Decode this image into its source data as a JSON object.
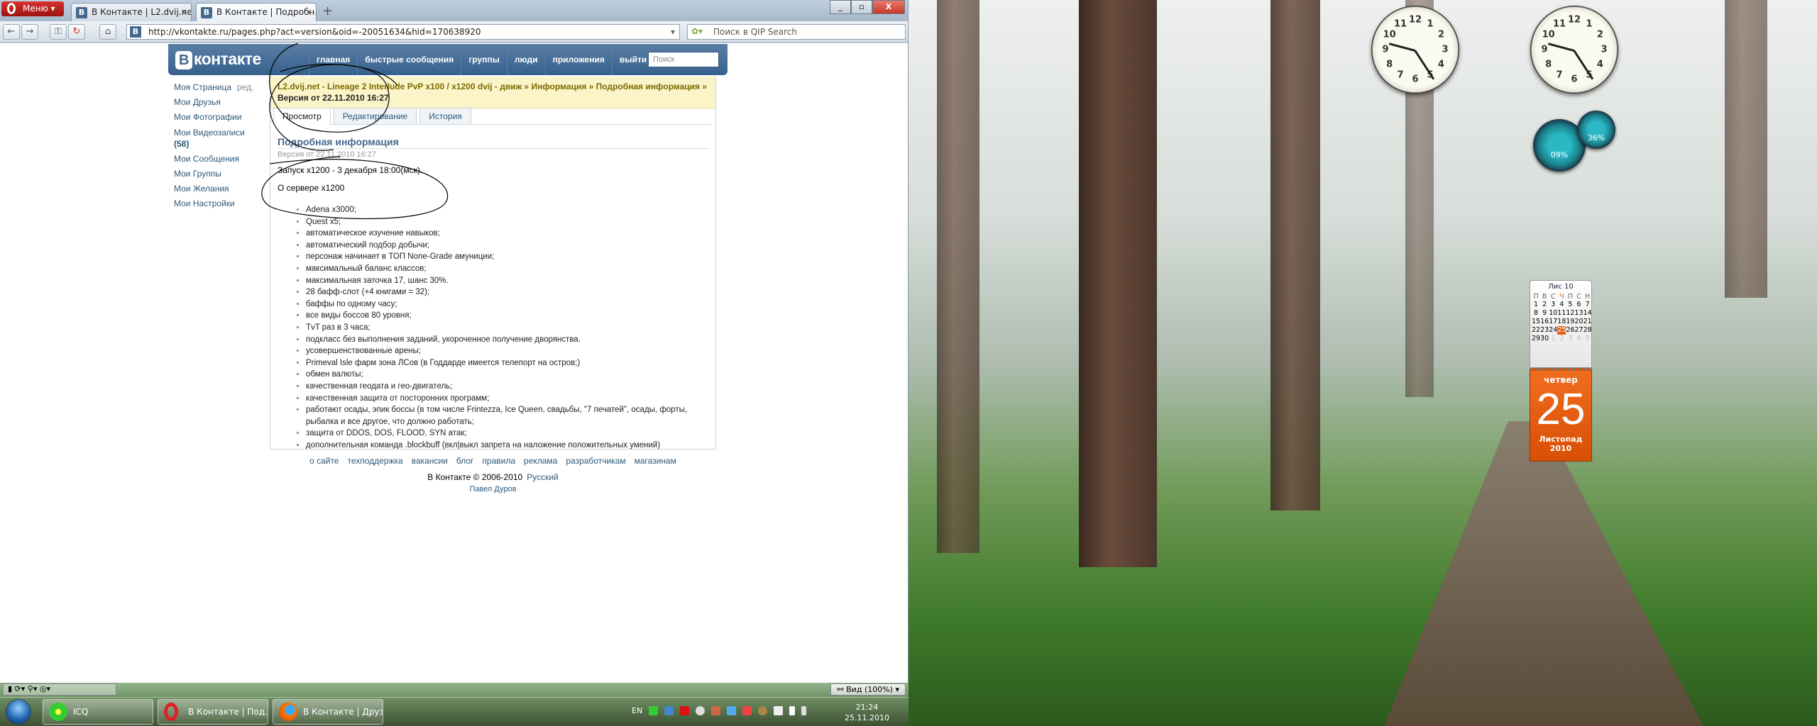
{
  "browser": {
    "menu_label": "Меню",
    "tabs": [
      {
        "label": "В Контакте | L2.dvij.ne...",
        "active": false
      },
      {
        "label": "В Контакте | Подробн...",
        "active": true
      }
    ],
    "url": "http://vkontakte.ru/pages.php?act=version&oid=-20051634&hid=170638920",
    "search_placeholder": "Поиск в QIP Search",
    "zoom_label": "Вид (100%)"
  },
  "vk": {
    "logo": "контакте",
    "logo_letter": "В",
    "nav": [
      "главная",
      "быстрые сообщения",
      "группы",
      "люди",
      "приложения",
      "выйти"
    ],
    "search_placeholder": "Поиск",
    "sidebar": [
      {
        "label": "Моя Страница",
        "extra": "ред."
      },
      {
        "label": "Мои Друзья"
      },
      {
        "label": "Мои Фотографии"
      },
      {
        "label": "Мои Видеозаписи",
        "count": "(58)"
      },
      {
        "label": "Мои Сообщения"
      },
      {
        "label": "Мои Группы"
      },
      {
        "label": "Мои Желания"
      },
      {
        "label": "Мои Настройки"
      }
    ],
    "breadcrumb": "L2.dvij.net - Lineage 2 Interlude PvP x100 / x1200 dvij - движ » Информация » Подробная информация »",
    "breadcrumb_current": "Версия от 22.11.2010 16:27",
    "tabs": [
      "Просмотр",
      "Редактирование",
      "История"
    ],
    "page_title": "Подробная информация",
    "version_line": "Версия от 22.11.2010 16:27",
    "launch": "Запуск x1200 - 3 декабря 18:00(мск).",
    "about": "О сервере x1200",
    "features": [
      "Adena x3000;",
      "Quest x5;",
      "автоматическое изучение навыков;",
      "автоматический подбор добычи;",
      "персонаж начинает в ТОП None-Grade амуниции;",
      "максимальный баланс классов;",
      "максимальная заточка 17, шанс 30%.",
      "28 бафф-слот (+4 книгами = 32);",
      "баффы по одному часу;",
      "все виды боссов 80 уровня;",
      "TvT раз в 3 часа;",
      "подкласс без выполнения заданий, укороченное получение дворянства.",
      "усовершенствованные арены;",
      "Primeval Isle фарм зона ЛСов (в Годдарде имеется телепорт на остров;)",
      "обмен валюты;",
      "качественная геодата и гео-двигатель;",
      "качественная защита от посторонних программ;",
      "работают осады, эпик боссы (в том числе Frintezza, Ice Queen, свадьбы, \"7 печатей\", осады, форты, рыбалка и все другое, что должно работать;",
      "защита от DDOS, DOS, FLOOD, SYN атак;",
      "дополнительная команда .blockbuff (вкл|выкл запрета на наложение положительных умений)"
    ],
    "footer_links": [
      "о сайте",
      "техподдержка",
      "вакансии",
      "блог",
      "правила",
      "реклама",
      "разработчикам",
      "магазинам"
    ],
    "copyright": "В Контакте © 2006-2010",
    "language": "Русский",
    "author": "Павел Дуров"
  },
  "taskbar": {
    "items": [
      {
        "label": "ICQ",
        "icon": "icq-flower-icon"
      },
      {
        "label": "В Контакте | Под...",
        "icon": "opera-icon"
      },
      {
        "label": "В Контакте | Друз...",
        "icon": "firefox-icon"
      }
    ],
    "lang": "EN",
    "time": "21:24",
    "date": "25.11.2010"
  },
  "gadgets": {
    "cpu": "09%",
    "ram": "36%",
    "cpu_number": "7",
    "calendar": {
      "month_short": "Лис 10",
      "weekdays": [
        "П",
        "В",
        "С",
        "Ч",
        "П",
        "С",
        "Н"
      ],
      "weeks": [
        [
          "1",
          "2",
          "3",
          "4",
          "5",
          "6",
          "7"
        ],
        [
          "8",
          "9",
          "10",
          "11",
          "12",
          "13",
          "14"
        ],
        [
          "15",
          "16",
          "17",
          "18",
          "19",
          "20",
          "21"
        ],
        [
          "22",
          "23",
          "24",
          "25",
          "26",
          "27",
          "28"
        ],
        [
          "29",
          "30",
          "1",
          "2",
          "3",
          "4",
          "5"
        ]
      ],
      "today": "25",
      "weekday": "четвер",
      "month_full": "Листопад 2010"
    },
    "clock_numbers": [
      "12",
      "1",
      "2",
      "3",
      "4",
      "5",
      "6",
      "7",
      "8",
      "9",
      "10",
      "11"
    ]
  },
  "colors": {
    "vk_blue": "#45688e",
    "opera_red": "#c8201c",
    "calendar_orange": "#e8600f"
  }
}
